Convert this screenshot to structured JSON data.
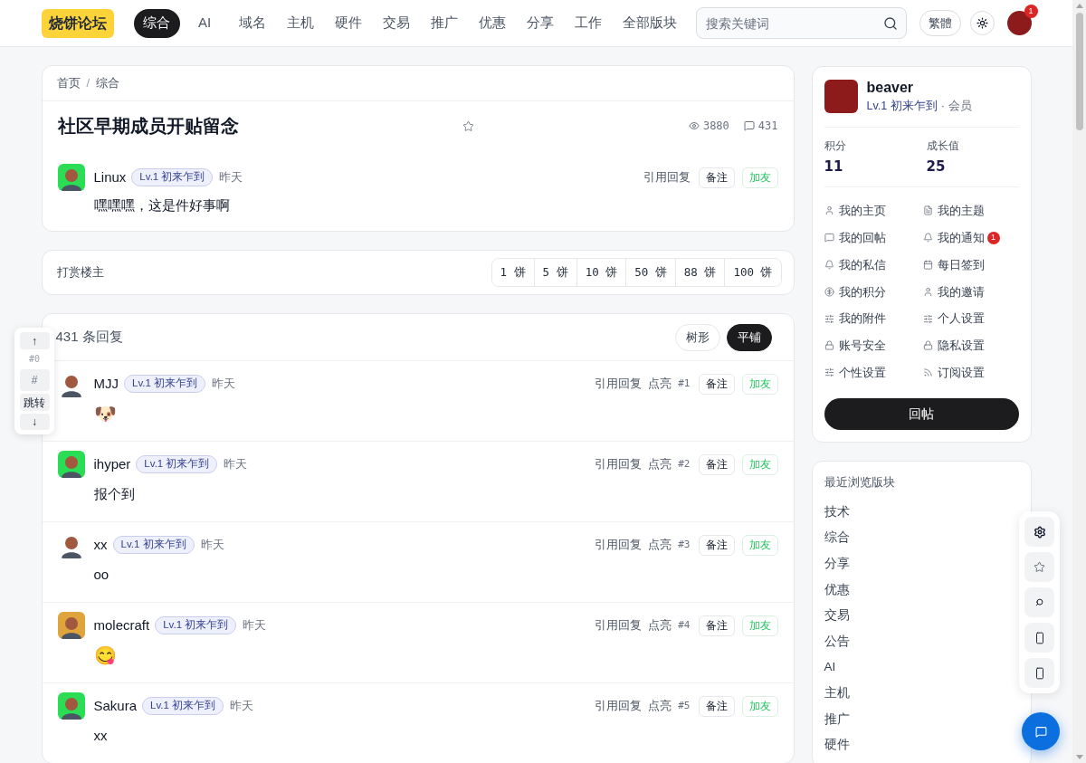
{
  "nav": {
    "logo": "烧饼论坛",
    "tabs": [
      {
        "label": "综合",
        "selected": true
      },
      {
        "label": "AI",
        "selected": false
      },
      {
        "label": "域名",
        "selected": false
      },
      {
        "label": "主机",
        "selected": false
      },
      {
        "label": "硬件",
        "selected": false
      },
      {
        "label": "交易",
        "selected": false
      },
      {
        "label": "推广",
        "selected": false
      },
      {
        "label": "优惠",
        "selected": false
      },
      {
        "label": "分享",
        "selected": false
      },
      {
        "label": "工作",
        "selected": false
      },
      {
        "label": "全部版块",
        "selected": false
      }
    ],
    "search": {
      "placeholder": "搜索关键词"
    },
    "language_button": "繁體",
    "notification_badge": "1"
  },
  "jump_panel": {
    "up": "↑",
    "current_floor": "#0",
    "floor_input": {
      "placeholder": "#"
    },
    "jump": "跳转",
    "down": "↓"
  },
  "post": {
    "breadcrumb": [
      "首页",
      "综合"
    ],
    "breadcrumb_separator": "/",
    "title": "社区早期成员开贴留念",
    "favorited": false,
    "views": "3880",
    "comments": "431",
    "author": {
      "name": "Linux",
      "level": "Lv.1 初来乍到",
      "time": "昨天",
      "color": "#2bdc55"
    },
    "quote": "引用回复",
    "note": "备注",
    "add_friend": "加友",
    "body": "嘿嘿嘿，这是件好事啊"
  },
  "tip": {
    "label": "打赏楼主",
    "amounts": [
      "1 饼",
      "5 饼",
      "10 饼",
      "50 饼",
      "88 饼",
      "100 饼"
    ]
  },
  "replies": {
    "count": "431 条回复",
    "views": [
      {
        "label": "树形",
        "selected": false
      },
      {
        "label": "平铺",
        "selected": true
      }
    ],
    "items": [
      {
        "name": "MJJ",
        "level": "Lv.1 初来乍到",
        "time": "昨天",
        "color": "#ffffff",
        "quote": "引用回复",
        "highlight": "点亮",
        "floor": "#1",
        "note": "备注",
        "add_friend": "加友",
        "kind": "emoji",
        "body": "🐶"
      },
      {
        "name": "ihyper",
        "level": "Lv.1 初来乍到",
        "time": "昨天",
        "color": "#2bdc55",
        "quote": "引用回复",
        "highlight": "点亮",
        "floor": "#2",
        "note": "备注",
        "add_friend": "加友",
        "kind": "text",
        "body": "报个到"
      },
      {
        "name": "xx",
        "level": "Lv.1 初来乍到",
        "time": "昨天",
        "color": "#ffffff",
        "quote": "引用回复",
        "highlight": "点亮",
        "floor": "#3",
        "note": "备注",
        "add_friend": "加友",
        "kind": "text",
        "body": "oo"
      },
      {
        "name": "molecraft",
        "level": "Lv.1 初来乍到",
        "time": "昨天",
        "color": "#e0a43c",
        "quote": "引用回复",
        "highlight": "点亮",
        "floor": "#4",
        "note": "备注",
        "add_friend": "加友",
        "kind": "emoji",
        "body": "😋"
      },
      {
        "name": "Sakura",
        "level": "Lv.1 初来乍到",
        "time": "昨天",
        "color": "#2bdc55",
        "quote": "引用回复",
        "highlight": "点亮",
        "floor": "#5",
        "note": "备注",
        "add_friend": "加友",
        "kind": "text",
        "body": "xx"
      }
    ]
  },
  "profile": {
    "name": "beaver",
    "level": "Lv.1 初来乍到",
    "separator": "·",
    "role": "会员",
    "stats": [
      {
        "label": "积分",
        "value": "11"
      },
      {
        "label": "成长值",
        "value": "25"
      }
    ],
    "menu": [
      {
        "label": "我的主页",
        "kind": "profile"
      },
      {
        "label": "我的主题",
        "kind": "topics"
      },
      {
        "label": "我的回帖",
        "kind": "replies"
      },
      {
        "label": "我的通知",
        "kind": "notifications",
        "badge": "1"
      },
      {
        "label": "我的私信",
        "kind": "messages"
      },
      {
        "label": "每日签到",
        "kind": "checkin"
      },
      {
        "label": "我的积分",
        "kind": "points"
      },
      {
        "label": "我的邀请",
        "kind": "invites"
      },
      {
        "label": "我的附件",
        "kind": "attachments"
      },
      {
        "label": "个人设置",
        "kind": "settings"
      },
      {
        "label": "账号安全",
        "kind": "security"
      },
      {
        "label": "隐私设置",
        "kind": "privacy"
      },
      {
        "label": "个性设置",
        "kind": "personalization"
      },
      {
        "label": "订阅设置",
        "kind": "subscriptions"
      }
    ],
    "reply_button": "回帖"
  },
  "recent_boards": {
    "title": "最近浏览版块",
    "items": [
      "技术",
      "综合",
      "分享",
      "优惠",
      "交易",
      "公告",
      "AI",
      "主机",
      "推广",
      "硬件"
    ]
  }
}
